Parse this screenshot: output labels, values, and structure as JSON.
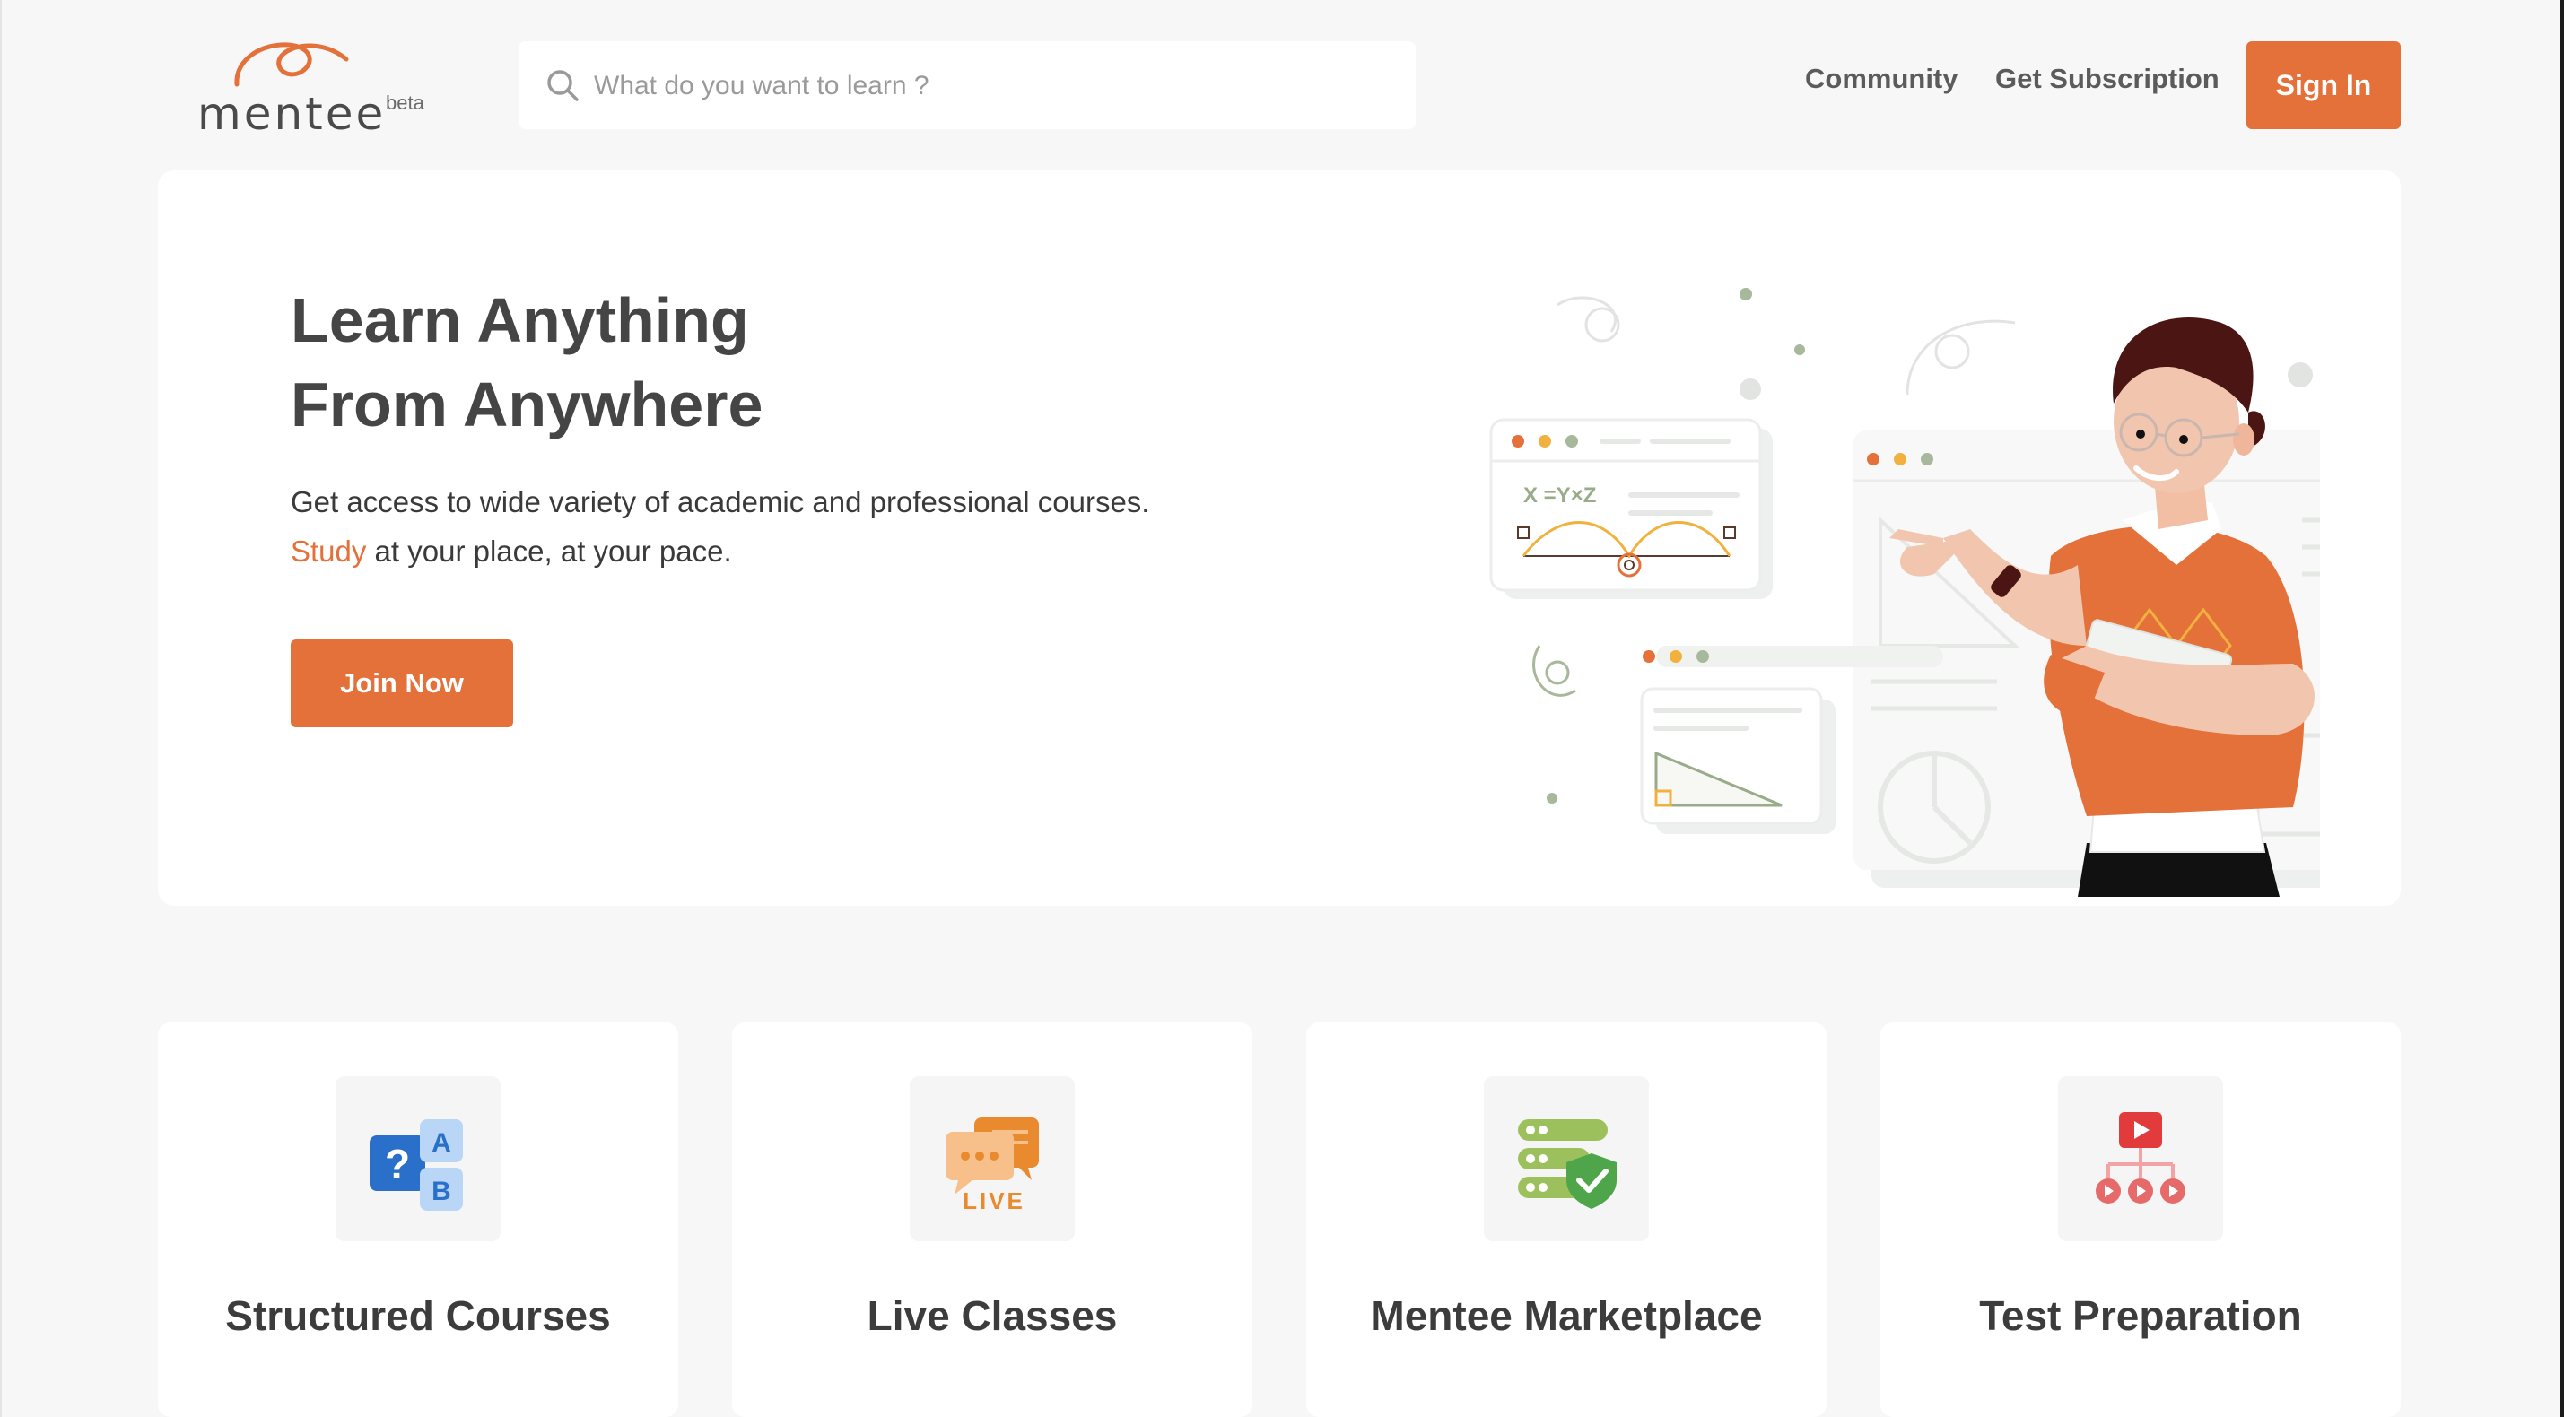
{
  "brand": {
    "name": "mentee",
    "badge": "beta",
    "accent_color": "#e4703a"
  },
  "search": {
    "placeholder": "What do you want to learn ?",
    "value": "",
    "icon": "search-icon"
  },
  "nav": {
    "community": "Community",
    "subscription": "Get Subscription",
    "sign_in": "Sign In"
  },
  "hero": {
    "title_line1": "Learn Anything",
    "title_line2": "From Anywhere",
    "desc_line1": "Get access to wide variety of academic and professional courses.",
    "desc_highlight": "Study",
    "desc_line2_rest": " at your place, at your pace.",
    "cta": "Join Now",
    "illustration_text": "X =Y×Z",
    "illustration": "teacher-pointing-at-screens"
  },
  "features": [
    {
      "title": "Structured Courses",
      "icon": "quiz-ab-icon",
      "icon_letters": [
        "A",
        "B"
      ],
      "icon_symbol": "?"
    },
    {
      "title": "Live Classes",
      "icon": "live-chat-icon",
      "icon_label": "LIVE"
    },
    {
      "title": "Mentee Marketplace",
      "icon": "secure-server-icon"
    },
    {
      "title": "Test Preparation",
      "icon": "video-playlist-icon"
    }
  ]
}
